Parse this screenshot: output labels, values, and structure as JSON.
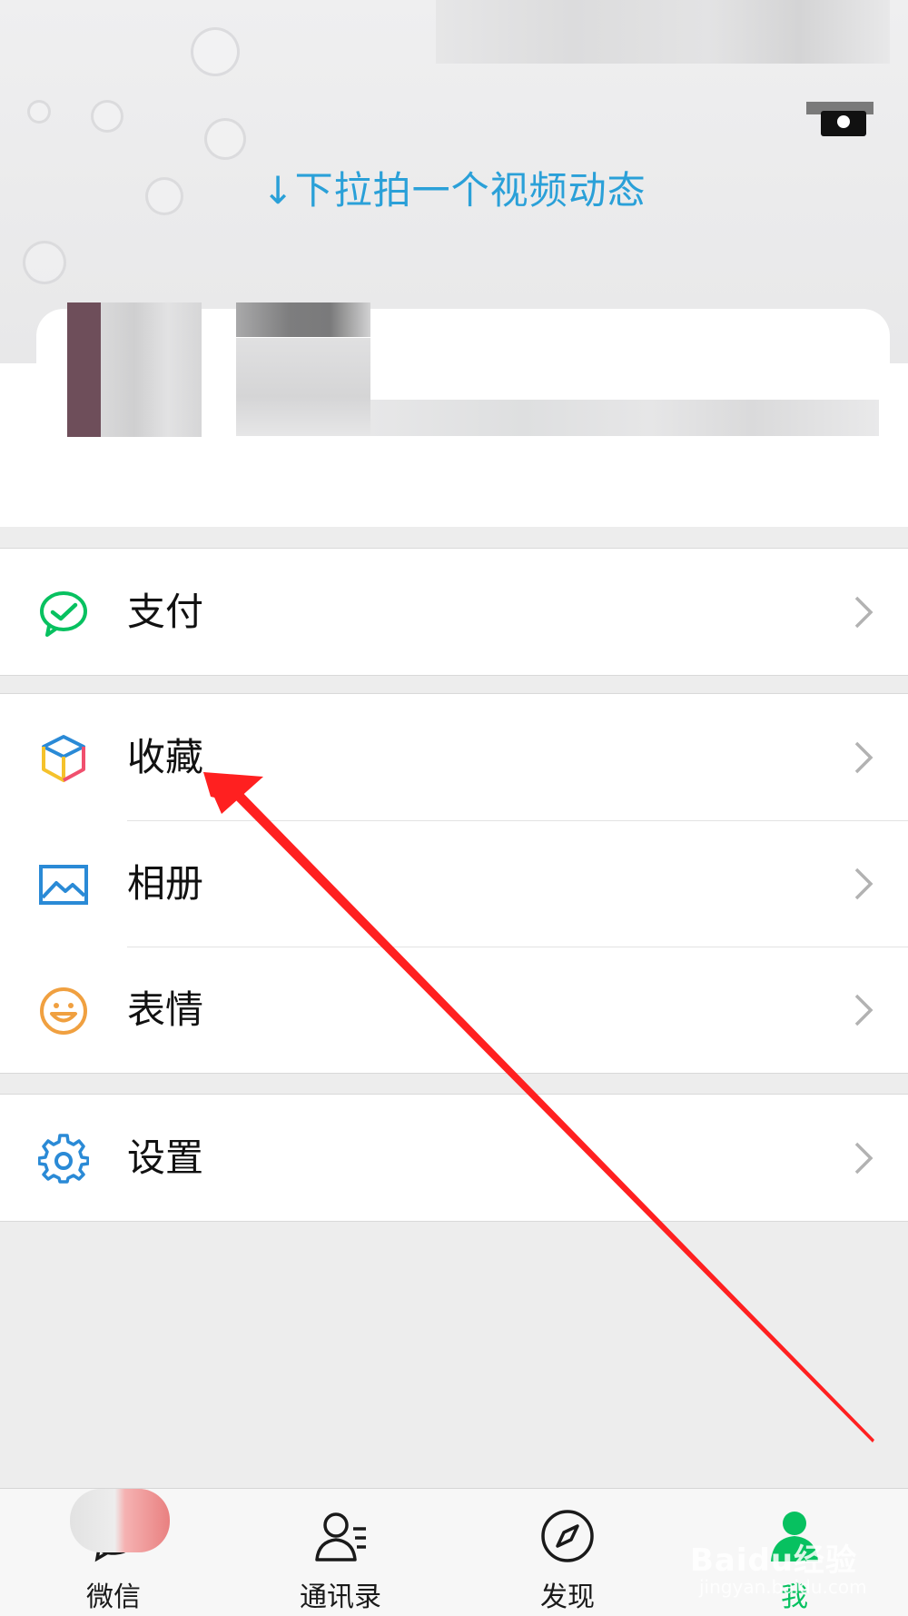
{
  "header": {
    "pull_hint": "↓下拉拍一个视频动态"
  },
  "menu": {
    "groups": [
      {
        "items": [
          {
            "label": "支付",
            "icon": "wechat-pay-icon",
            "color": "#07c160"
          }
        ]
      },
      {
        "items": [
          {
            "label": "收藏",
            "icon": "favorites-cube-icon",
            "color": "#f5a623"
          },
          {
            "label": "相册",
            "icon": "album-icon",
            "color": "#2a8ad6"
          },
          {
            "label": "表情",
            "icon": "sticker-smile-icon",
            "color": "#f0a040"
          }
        ]
      },
      {
        "items": [
          {
            "label": "设置",
            "icon": "settings-gear-icon",
            "color": "#2a8ad6"
          }
        ]
      }
    ]
  },
  "tabbar": {
    "tabs": [
      {
        "label": "微信",
        "icon": "chat-icon"
      },
      {
        "label": "通讯录",
        "icon": "contacts-icon"
      },
      {
        "label": "发现",
        "icon": "compass-icon"
      },
      {
        "label": "我",
        "icon": "me-icon",
        "active": true
      }
    ]
  },
  "colors": {
    "accent_green": "#07c160",
    "hint_blue": "#2aa0d8",
    "annotation_red": "#ff2020"
  },
  "watermark": {
    "brand": "Baidu经验",
    "url": "jingyan.baidu.com"
  }
}
